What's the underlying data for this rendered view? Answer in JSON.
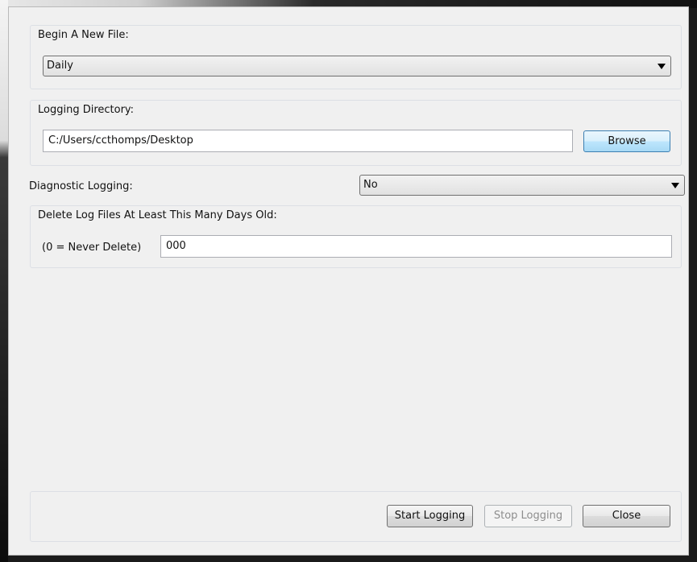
{
  "new_file": {
    "title": "Begin A New File:",
    "selected": "Daily"
  },
  "log_dir": {
    "title": "Logging Directory:",
    "path": "C:/Users/ccthomps/Desktop",
    "browse_label": "Browse"
  },
  "diagnostic": {
    "label": "Diagnostic Logging:",
    "selected": "No"
  },
  "delete_old": {
    "title": "Delete Log Files At Least This Many Days Old:",
    "hint": "(0 = Never Delete)",
    "days": "000"
  },
  "footer": {
    "start_label": "Start Logging",
    "stop_label": "Stop Logging",
    "close_label": "Close"
  }
}
